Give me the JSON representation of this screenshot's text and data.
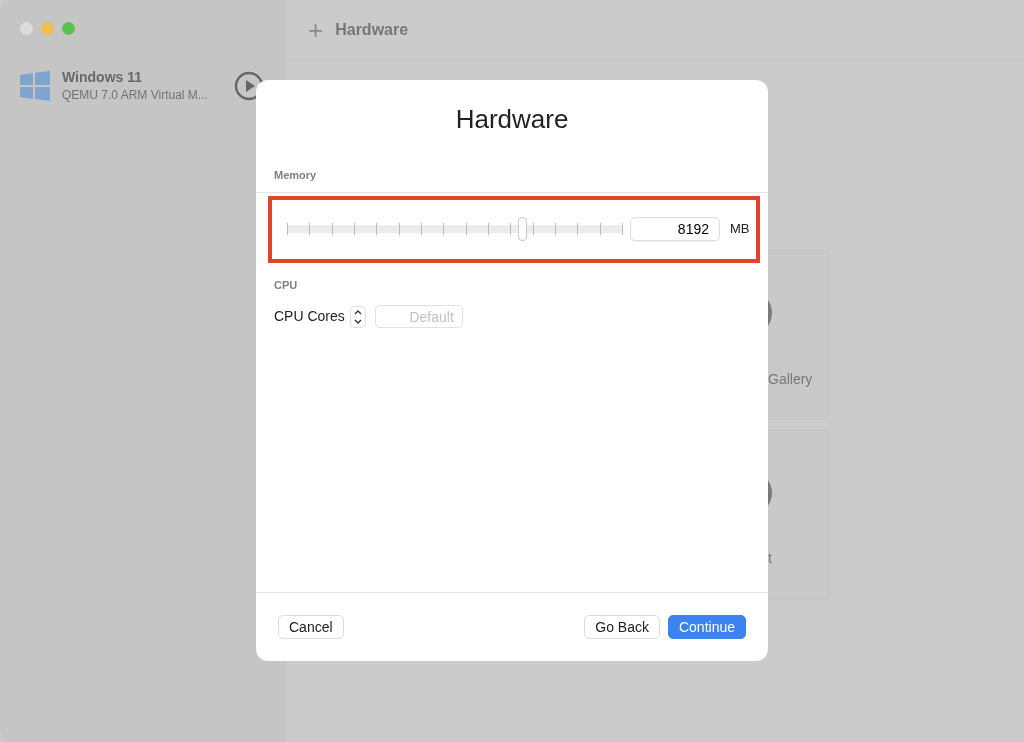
{
  "window": {
    "traffic_lights": [
      {
        "color": "#dcdcdc"
      },
      {
        "color": "#f2be4a"
      },
      {
        "color": "#5cc24e"
      }
    ]
  },
  "toolbar": {
    "add_label": "+",
    "title": "Hardware"
  },
  "sidebar": {
    "items": [
      {
        "title": "Windows 11",
        "subtitle": "QEMU 7.0 ARM Virtual M...",
        "selected": false
      }
    ]
  },
  "background_cards": [
    {
      "label": "Gallery"
    },
    {
      "label": "t"
    }
  ],
  "dialog": {
    "title": "Hardware",
    "memory": {
      "heading": "Memory",
      "level": 0.7,
      "value": "8192",
      "unit": "MB",
      "highlighted": true
    },
    "cpu": {
      "heading": "CPU",
      "label": "CPU Cores",
      "placeholder": "Default"
    },
    "buttons": [
      {
        "label": "Cancel",
        "kind": "plain"
      },
      {
        "label": "Go Back",
        "kind": "plain"
      },
      {
        "label": "Continue",
        "kind": "primary"
      }
    ]
  }
}
